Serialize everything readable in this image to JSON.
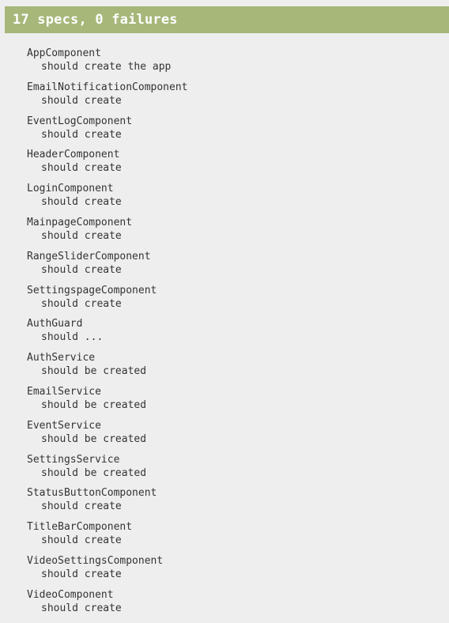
{
  "summary": {
    "text": "17 specs, 0 failures",
    "bar_color": "#a6b779"
  },
  "suites": [
    {
      "name": "AppComponent",
      "spec": "should create the app"
    },
    {
      "name": "EmailNotificationComponent",
      "spec": "should create"
    },
    {
      "name": "EventLogComponent",
      "spec": "should create"
    },
    {
      "name": "HeaderComponent",
      "spec": "should create"
    },
    {
      "name": "LoginComponent",
      "spec": "should create"
    },
    {
      "name": "MainpageComponent",
      "spec": "should create"
    },
    {
      "name": "RangeSliderComponent",
      "spec": "should create"
    },
    {
      "name": "SettingspageComponent",
      "spec": "should create"
    },
    {
      "name": "AuthGuard",
      "spec": "should ..."
    },
    {
      "name": "AuthService",
      "spec": "should be created"
    },
    {
      "name": "EmailService",
      "spec": "should be created"
    },
    {
      "name": "EventService",
      "spec": "should be created"
    },
    {
      "name": "SettingsService",
      "spec": "should be created"
    },
    {
      "name": "StatusButtonComponent",
      "spec": "should create"
    },
    {
      "name": "TitleBarComponent",
      "spec": "should create"
    },
    {
      "name": "VideoSettingsComponent",
      "spec": "should create"
    },
    {
      "name": "VideoComponent",
      "spec": "should create"
    }
  ]
}
